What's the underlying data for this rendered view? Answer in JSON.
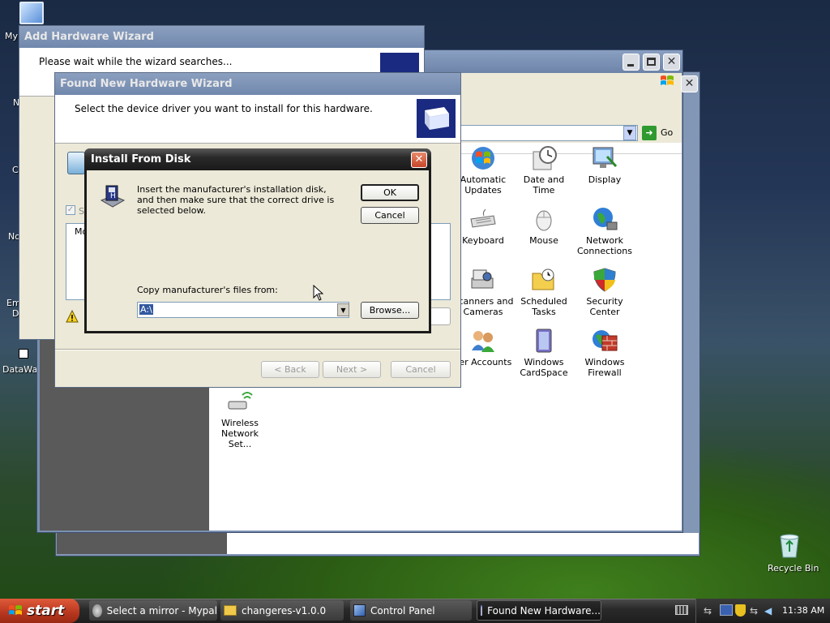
{
  "desktop": {
    "icon_labels": [
      "My",
      "N",
      "C",
      "No",
      "Em",
      "D",
      "DataWa"
    ],
    "recycle_bin": "Recycle Bin"
  },
  "add_hw_wizard": {
    "title": "Add Hardware Wizard",
    "message": "Please wait while the wizard searches..."
  },
  "control_panel": {
    "go_label": "Go",
    "items": [
      {
        "label": "Automatic Updates",
        "icon": "windows-flag-icon"
      },
      {
        "label": "Date and Time",
        "icon": "clock-icon"
      },
      {
        "label": "Display",
        "icon": "display-icon"
      },
      {
        "label": "Keyboard",
        "icon": "keyboard-icon"
      },
      {
        "label": "Mouse",
        "icon": "mouse-icon"
      },
      {
        "label": "Network Connections",
        "icon": "network-globe-icon"
      },
      {
        "label": "Scanners and Cameras",
        "icon": "scanner-icon"
      },
      {
        "label": "Scheduled Tasks",
        "icon": "scheduled-tasks-icon"
      },
      {
        "label": "Security Center",
        "icon": "shield-icon"
      },
      {
        "label": "ser Accounts",
        "icon": "users-icon"
      },
      {
        "label": "Windows CardSpace",
        "icon": "cardspace-icon"
      },
      {
        "label": "Windows Firewall",
        "icon": "firewall-icon"
      },
      {
        "label": "Wireless Network Set...",
        "icon": "wireless-icon"
      }
    ]
  },
  "found_hw_wizard": {
    "title": "Found New Hardware Wizard",
    "header": "Select the device driver you want to install for this hardware.",
    "checkbox_letter": "S",
    "list_letter": "Mo",
    "back_label": "< Back",
    "next_label": "Next >",
    "cancel_label": "Cancel"
  },
  "install_dialog": {
    "title": "Install From Disk",
    "message": "Insert the manufacturer's installation disk, and then make sure that the correct drive is selected below.",
    "ok_label": "OK",
    "cancel_label": "Cancel",
    "copy_label": "Copy manufacturer's files from:",
    "path_value": "A:\\",
    "browse_label": "Browse..."
  },
  "taskbar": {
    "start_label": "start",
    "buttons": [
      {
        "label": "Select a mirror - Mypal",
        "active": false
      },
      {
        "label": "changeres-v1.0.0",
        "active": false
      },
      {
        "label": "Control Panel",
        "active": false
      },
      {
        "label": "Found New Hardware...",
        "active": true
      }
    ],
    "clock": "11:38 AM"
  }
}
